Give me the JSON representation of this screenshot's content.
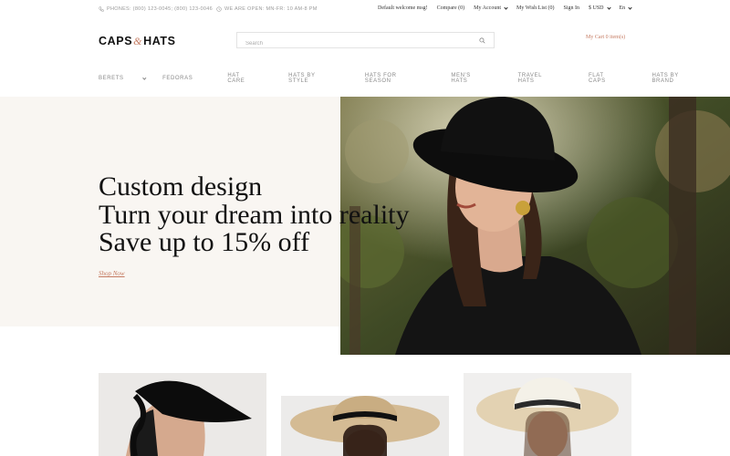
{
  "topbar": {
    "phones": "PHONES: (800) 123-0045; (800) 123-0046",
    "hours": "WE ARE OPEN: MN-FR: 10 AM-8 PM",
    "welcome": "Default welcome msg!",
    "compare": "Compare (0)",
    "account": "My Account",
    "wishlist": "My Wish List (0)",
    "signin": "Sign In",
    "currency": "$ USD",
    "language": "En"
  },
  "header": {
    "logo_part1": "CAPS",
    "logo_amp": "&",
    "logo_part2": "HATS",
    "search_placeholder": "Search",
    "cart": "My Cart 0 item(s)"
  },
  "nav": {
    "items": [
      "BERETS",
      "FEDORAS",
      "HAT CARE",
      "HATS BY STYLE",
      "HATS FOR SEASON",
      "MEN'S HATS",
      "TRAVEL HATS",
      "FLAT CAPS",
      "HATS BY BRAND"
    ]
  },
  "hero": {
    "line1": "Custom design",
    "line2": "Turn your dream into reality",
    "line3": "Save up to 15% off",
    "cta": "Shop Now"
  },
  "colors": {
    "accent": "#c57b62",
    "hero_bg": "#f9f6f2"
  },
  "icons": {
    "phone": "phone-icon",
    "clock": "clock-icon",
    "search": "search-icon"
  }
}
